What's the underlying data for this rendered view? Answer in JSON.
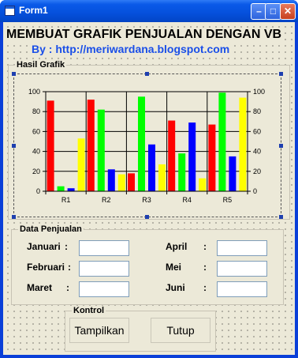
{
  "window": {
    "title": "Form1"
  },
  "header": {
    "title": "MEMBUAT GRAFIK PENJUALAN DENGAN VB",
    "subtitle": "By : http://meriwardana.blogspot.com"
  },
  "chart_frame": {
    "label": "Hasil Grafik"
  },
  "chart_data": {
    "type": "bar",
    "categories": [
      "R1",
      "R2",
      "R3",
      "R4",
      "R5"
    ],
    "series": [
      {
        "color": "#ff0000",
        "values": [
          91,
          92,
          18,
          71,
          67
        ]
      },
      {
        "color": "#00ff00",
        "values": [
          5,
          82,
          95,
          38,
          99
        ]
      },
      {
        "color": "#0000ff",
        "values": [
          3,
          22,
          47,
          69,
          35
        ]
      },
      {
        "color": "#ffff00",
        "values": [
          53,
          17,
          27,
          13,
          94
        ]
      }
    ],
    "ylim": [
      0,
      100
    ],
    "yticks": [
      "0",
      "20",
      "40",
      "60",
      "80",
      "100"
    ],
    "grid": true,
    "right_axis": true
  },
  "data_frame": {
    "label": "Data Penjualan",
    "fields": [
      {
        "label": "Januari",
        "sep": ":",
        "value": ""
      },
      {
        "label": "Februari",
        "sep": ":",
        "value": ""
      },
      {
        "label": "Maret",
        "sep": ":",
        "value": ""
      },
      {
        "label": "April",
        "sep": ":",
        "value": ""
      },
      {
        "label": "Mei",
        "sep": ":",
        "value": ""
      },
      {
        "label": "Juni",
        "sep": ":",
        "value": ""
      }
    ]
  },
  "control_frame": {
    "label": "Kontrol",
    "show_button": "Tampilkan",
    "close_button": "Tutup"
  }
}
